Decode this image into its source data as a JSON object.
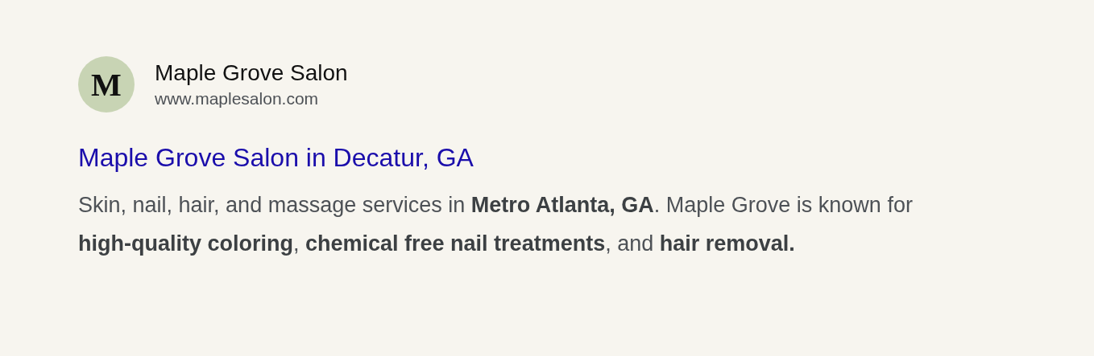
{
  "result": {
    "logo": {
      "letter": "M"
    },
    "site_name": "Maple Grove Salon",
    "url": "www.maplesalon.com",
    "title": "Maple Grove Salon in Decatur, GA",
    "snippet": "Skin, nail, hair, and massage services in **Metro Atlanta, GA**. Maple Grove is known for **high-quality coloring**, **chemical free nail treatments**, and **hair removal.**"
  }
}
